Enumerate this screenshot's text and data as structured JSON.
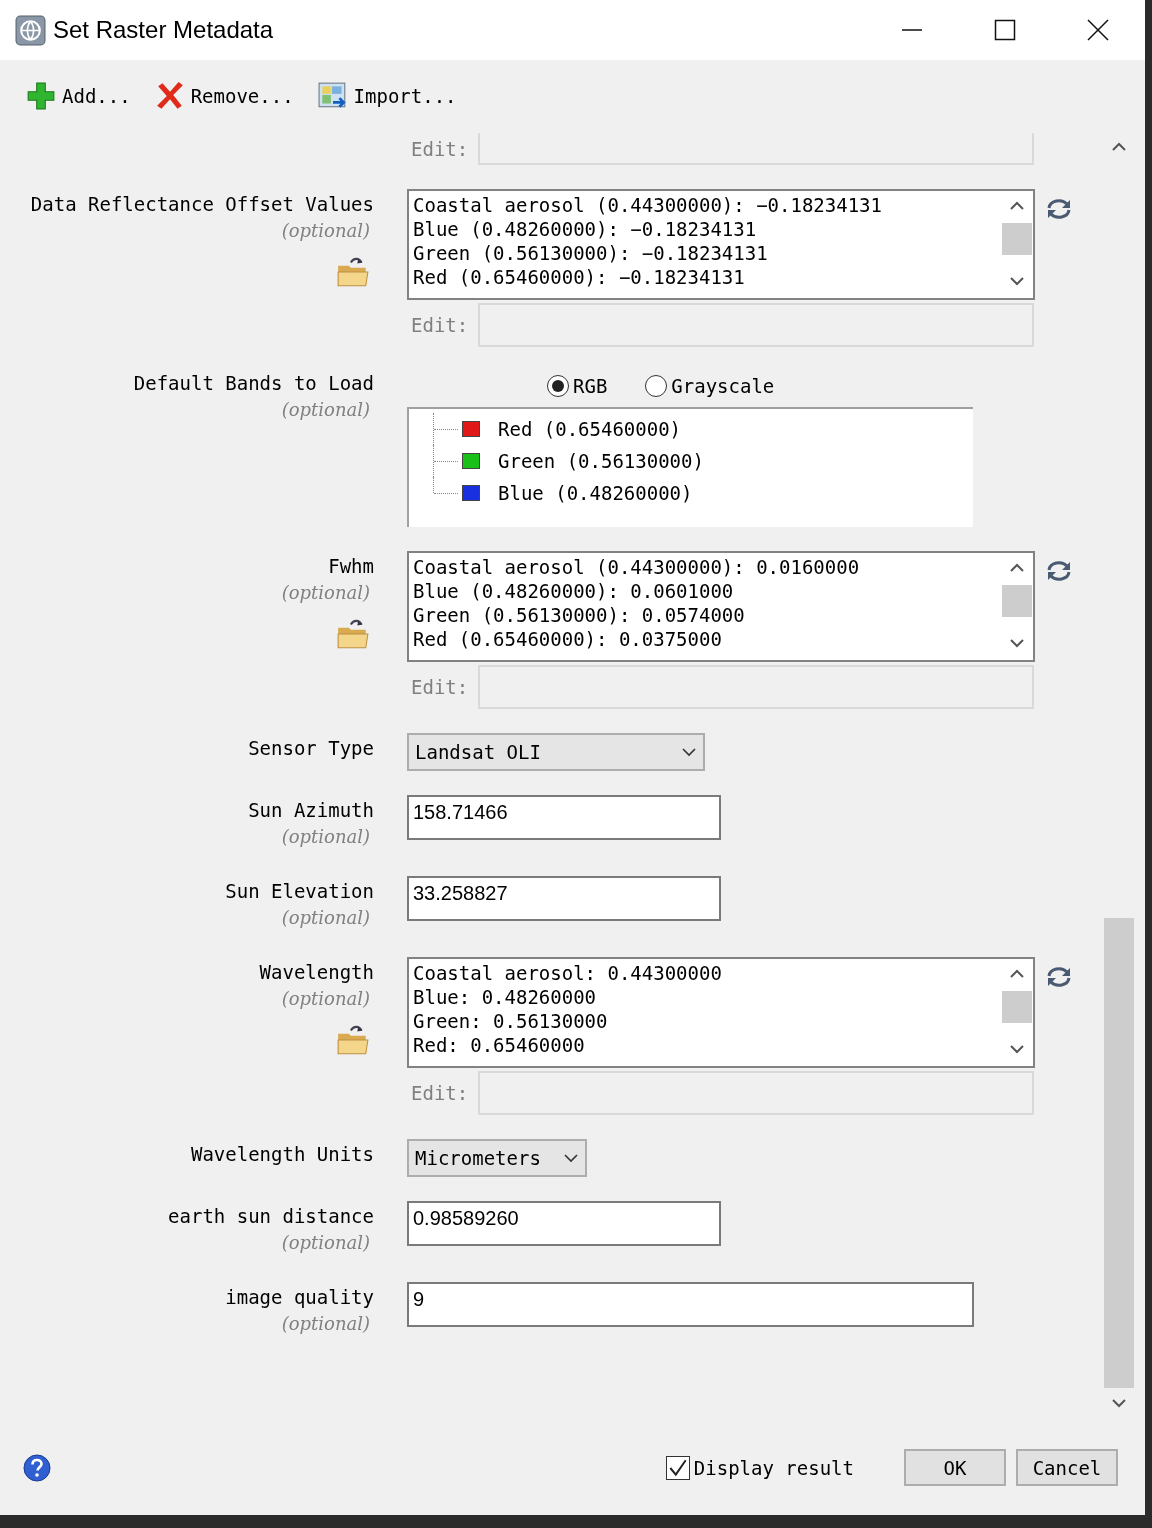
{
  "window": {
    "title": "Set Raster Metadata"
  },
  "toolbar": [
    {
      "kind": "add",
      "label": "Add..."
    },
    {
      "kind": "remove",
      "label": "Remove..."
    },
    {
      "kind": "import",
      "label": "Import..."
    }
  ],
  "fields": [
    {
      "kind": "edit",
      "edit_label": "Edit:"
    },
    {
      "kind": "list",
      "label": "Data Reflectance Offset Values",
      "optional": "(optional)",
      "folder": true,
      "items": [
        "Coastal aerosol (0.44300000): −0.18234131",
        "Blue (0.48260000): −0.18234131",
        "Green (0.56130000): −0.18234131",
        "Red (0.65460000): −0.18234131"
      ],
      "edit_label": "Edit:"
    },
    {
      "kind": "bands",
      "label": "Default Bands to Load",
      "optional": "(optional)",
      "modes": [
        {
          "label": "RGB",
          "selected": true
        },
        {
          "label": "Grayscale",
          "selected": false
        }
      ],
      "bands": [
        {
          "label": "Red (0.65460000)",
          "color": "#e01818"
        },
        {
          "label": "Green (0.56130000)",
          "color": "#18c018"
        },
        {
          "label": "Blue (0.48260000)",
          "color": "#1830e0"
        }
      ]
    },
    {
      "kind": "list",
      "label": "Fwhm",
      "optional": "(optional)",
      "folder": true,
      "items": [
        "Coastal aerosol (0.44300000): 0.0160000",
        "Blue (0.48260000): 0.0601000",
        "Green (0.56130000): 0.0574000",
        "Red (0.65460000): 0.0375000"
      ],
      "edit_label": "Edit:"
    },
    {
      "kind": "select",
      "label": "Sensor Type",
      "value": "Landsat OLI",
      "wide": true
    },
    {
      "kind": "text",
      "label": "Sun Azimuth",
      "optional": "(optional)",
      "value": "158.71466",
      "wide": false
    },
    {
      "kind": "text",
      "label": "Sun Elevation",
      "optional": "(optional)",
      "value": "33.258827",
      "wide": false
    },
    {
      "kind": "list",
      "label": "Wavelength",
      "optional": "(optional)",
      "folder": true,
      "items": [
        "Coastal aerosol: 0.44300000",
        "Blue: 0.48260000",
        "Green: 0.56130000",
        "Red: 0.65460000"
      ],
      "edit_label": "Edit:"
    },
    {
      "kind": "select",
      "label": "Wavelength Units",
      "value": "Micrometers",
      "wide": false
    },
    {
      "kind": "text",
      "label": "earth sun distance",
      "optional": "(optional)",
      "value": "0.98589260",
      "wide": false
    },
    {
      "kind": "text",
      "label": "image quality",
      "optional": "(optional)",
      "value": "9",
      "wide": true
    }
  ],
  "footer": {
    "display_result": {
      "label": "Display result",
      "checked": true
    },
    "buttons": [
      "OK",
      "Cancel"
    ]
  }
}
